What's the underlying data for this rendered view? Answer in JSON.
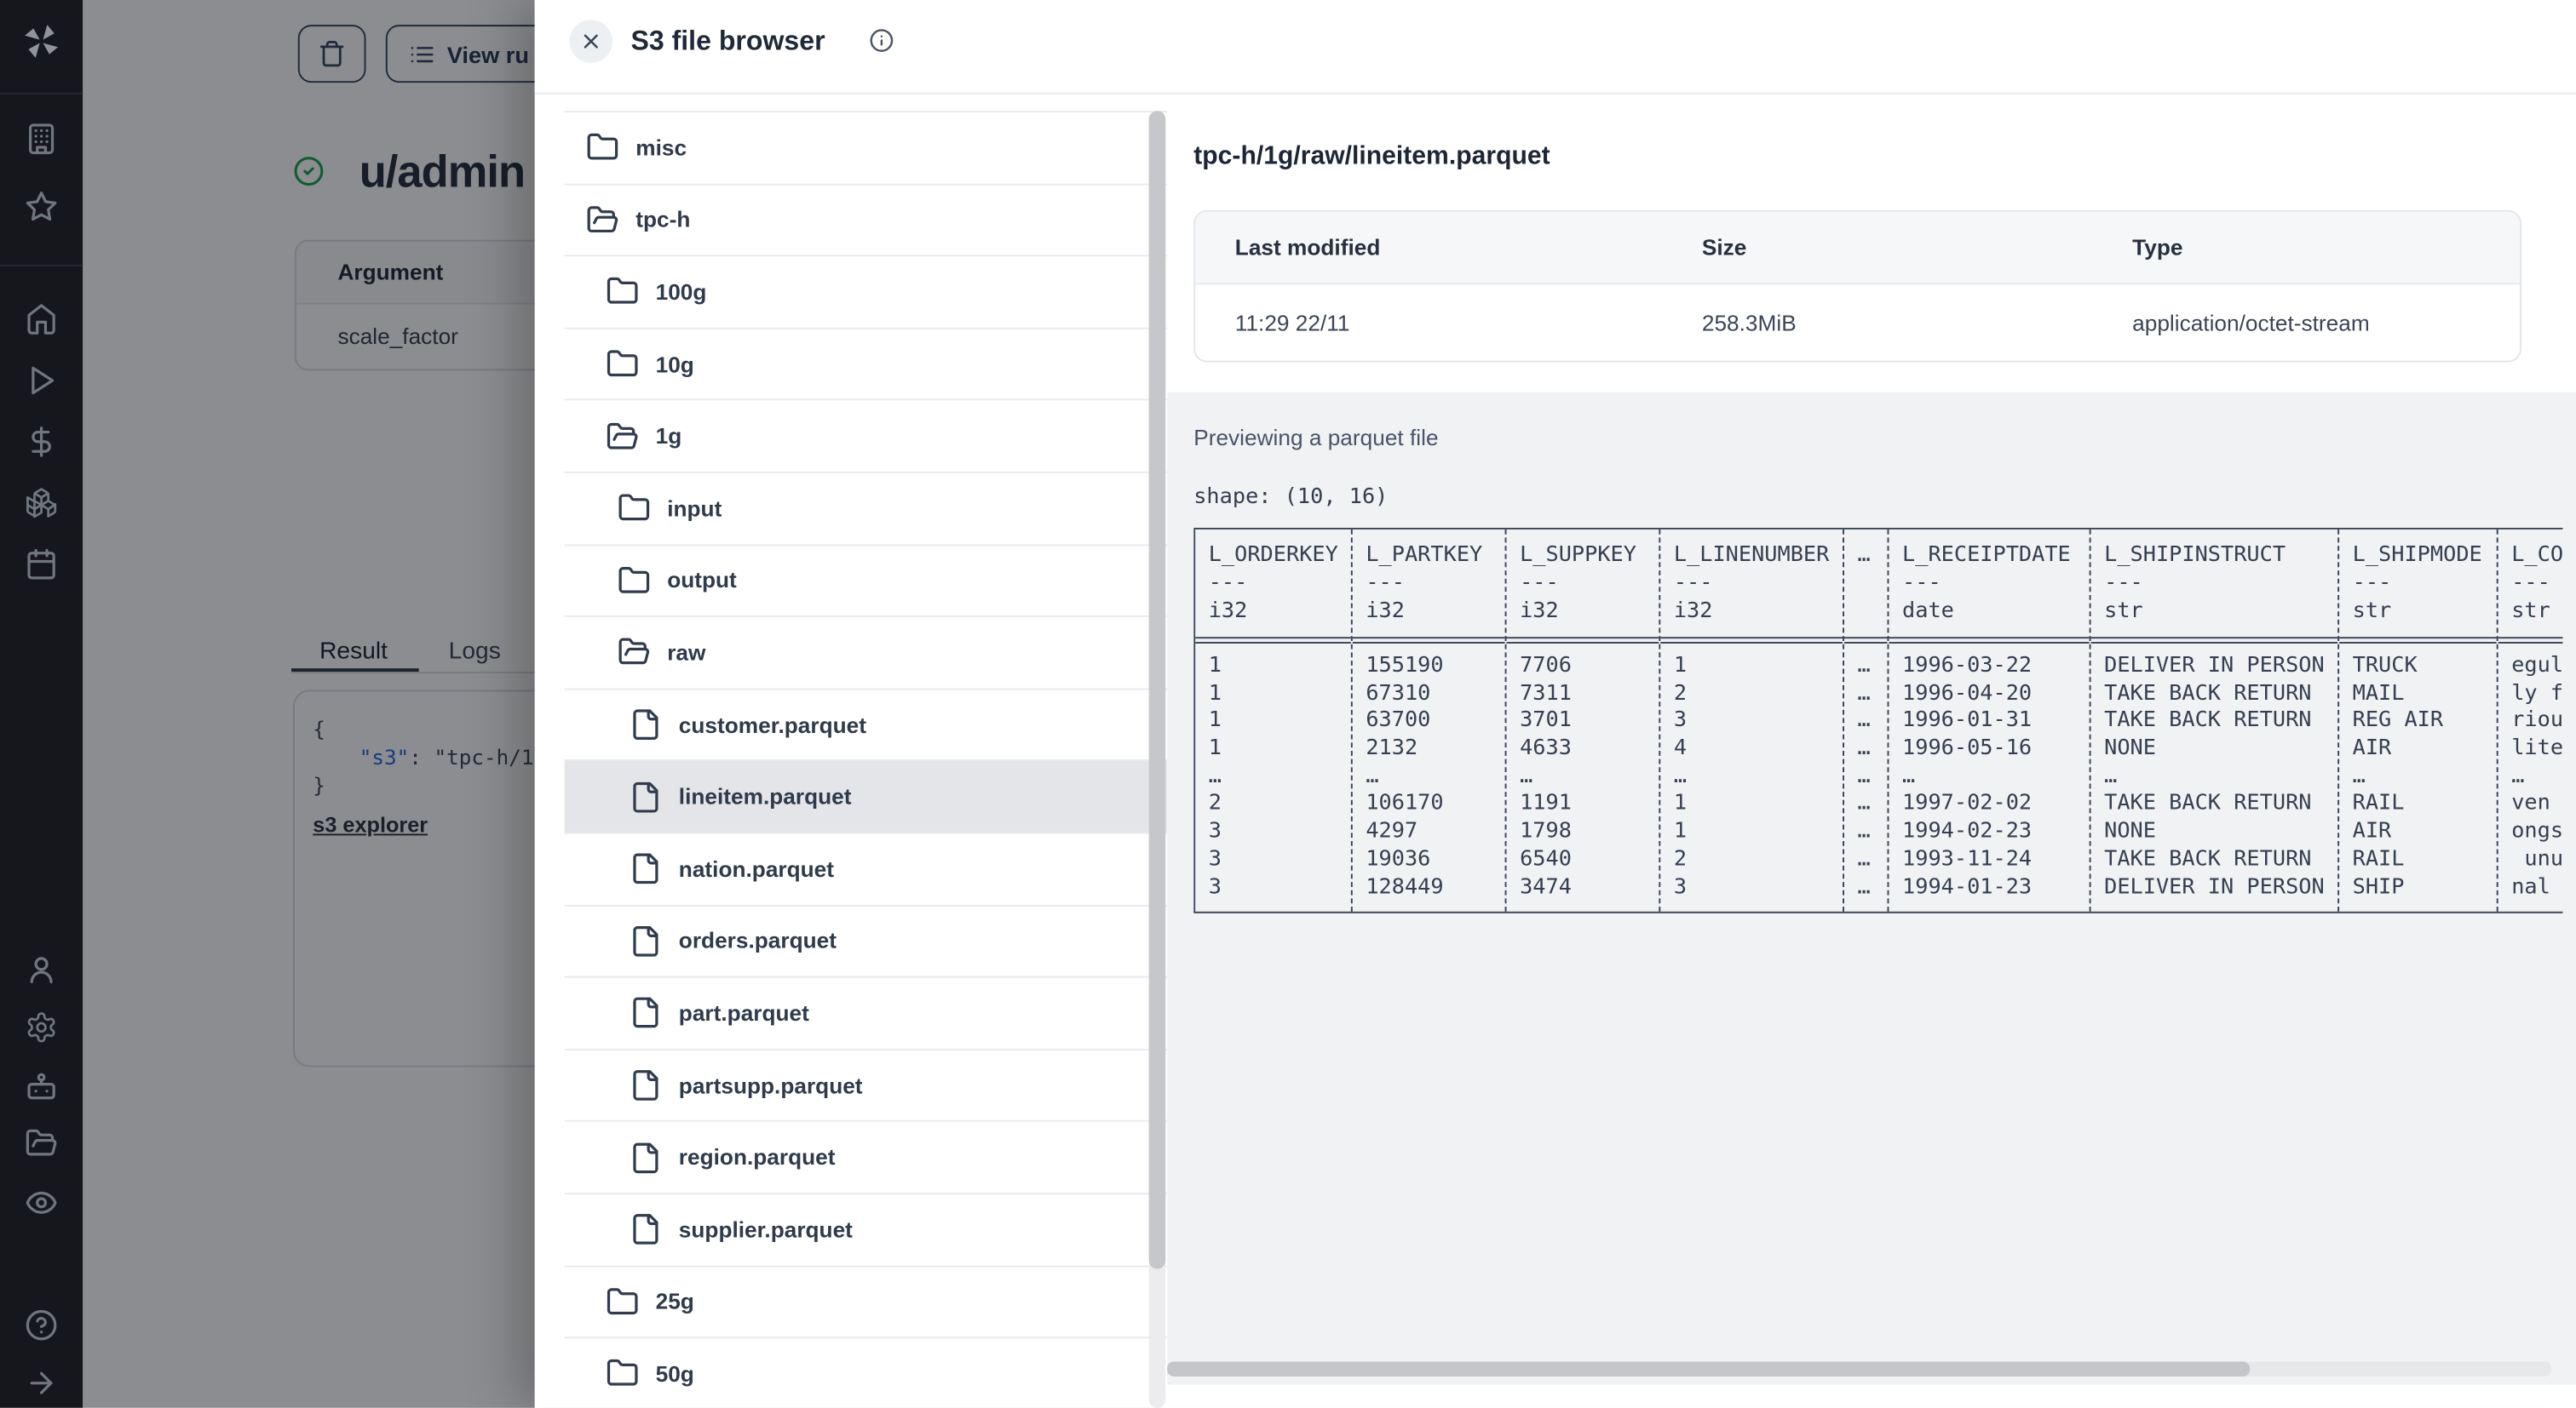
{
  "sidebar": {
    "logo": "windmill-logo",
    "top_icons": [
      "building",
      "star"
    ],
    "nav_icons": [
      "home",
      "play",
      "dollar",
      "boxes",
      "calendar"
    ],
    "bottom_icons": [
      "user",
      "settings",
      "bot",
      "folder-open",
      "eye"
    ],
    "footer_icons": [
      "help",
      "arrow-right"
    ]
  },
  "page": {
    "view_runs_label": "View ru",
    "title": "u/admin",
    "args_table": {
      "header": "Argument",
      "rows": [
        "scale_factor"
      ]
    },
    "tabs": {
      "items": [
        "Result",
        "Logs"
      ],
      "active": "Result"
    },
    "result_json": {
      "open_brace": "{",
      "key": "\"s3\"",
      "colon": ": ",
      "value": "\"tpc-h/1",
      "close_brace": "}"
    },
    "s3_explorer_link": "s3 explorer"
  },
  "modal": {
    "title": "S3 file browser",
    "close_label": "close",
    "tree": {
      "items": [
        {
          "label": "misc",
          "icon": "folder",
          "level": 0,
          "selected": false
        },
        {
          "label": "tpc-h",
          "icon": "folder-open",
          "level": 0,
          "selected": false
        },
        {
          "label": "100g",
          "icon": "folder",
          "level": 1,
          "selected": false
        },
        {
          "label": "10g",
          "icon": "folder",
          "level": 1,
          "selected": false
        },
        {
          "label": "1g",
          "icon": "folder-open",
          "level": 1,
          "selected": false
        },
        {
          "label": "input",
          "icon": "folder",
          "level": 2,
          "selected": false
        },
        {
          "label": "output",
          "icon": "folder",
          "level": 2,
          "selected": false
        },
        {
          "label": "raw",
          "icon": "folder-open",
          "level": 2,
          "selected": false
        },
        {
          "label": "customer.parquet",
          "icon": "file",
          "level": 3,
          "selected": false
        },
        {
          "label": "lineitem.parquet",
          "icon": "file",
          "level": 3,
          "selected": true
        },
        {
          "label": "nation.parquet",
          "icon": "file",
          "level": 3,
          "selected": false
        },
        {
          "label": "orders.parquet",
          "icon": "file",
          "level": 3,
          "selected": false
        },
        {
          "label": "part.parquet",
          "icon": "file",
          "level": 3,
          "selected": false
        },
        {
          "label": "partsupp.parquet",
          "icon": "file",
          "level": 3,
          "selected": false
        },
        {
          "label": "region.parquet",
          "icon": "file",
          "level": 3,
          "selected": false
        },
        {
          "label": "supplier.parquet",
          "icon": "file",
          "level": 3,
          "selected": false
        },
        {
          "label": "25g",
          "icon": "folder",
          "level": 1,
          "selected": false
        },
        {
          "label": "50g",
          "icon": "folder",
          "level": 1,
          "selected": false
        }
      ]
    },
    "preview": {
      "path": "tpc-h/1g/raw/lineitem.parquet",
      "meta": {
        "headers": [
          "Last modified",
          "Size",
          "Type"
        ],
        "values": [
          "11:29 22/11",
          "258.3MiB",
          "application/octet-stream"
        ]
      },
      "status_label": "Previewing a parquet file",
      "shape_label": "shape: (10, 16)",
      "type_separator": "---",
      "table": {
        "columns": [
          {
            "name": "L_ORDERKEY",
            "dtype": "i32",
            "values": [
              "1",
              "1",
              "1",
              "1",
              "…",
              "2",
              "3",
              "3",
              "3"
            ]
          },
          {
            "name": "L_PARTKEY",
            "dtype": "i32",
            "values": [
              "155190",
              "67310",
              "63700",
              "2132",
              "…",
              "106170",
              "4297",
              "19036",
              "128449"
            ]
          },
          {
            "name": "L_SUPPKEY",
            "dtype": "i32",
            "values": [
              "7706",
              "7311",
              "3701",
              "4633",
              "…",
              "1191",
              "1798",
              "6540",
              "3474"
            ]
          },
          {
            "name": "L_LINENUMBER",
            "dtype": "i32",
            "values": [
              "1",
              "2",
              "3",
              "4",
              "…",
              "1",
              "1",
              "2",
              "3"
            ]
          },
          {
            "name": "…",
            "dtype": "",
            "values": [
              "…",
              "…",
              "…",
              "…",
              "…",
              "…",
              "…",
              "…",
              "…"
            ]
          },
          {
            "name": "L_RECEIPTDATE",
            "dtype": "date",
            "values": [
              "1996-03-22",
              "1996-04-20",
              "1996-01-31",
              "1996-05-16",
              "…",
              "1997-02-02",
              "1994-02-23",
              "1993-11-24",
              "1994-01-23"
            ]
          },
          {
            "name": "L_SHIPINSTRUCT",
            "dtype": "str",
            "values": [
              "DELIVER IN PERSON",
              "TAKE BACK RETURN",
              "TAKE BACK RETURN",
              "NONE",
              "…",
              "TAKE BACK RETURN",
              "NONE",
              "TAKE BACK RETURN",
              "DELIVER IN PERSON"
            ]
          },
          {
            "name": "L_SHIPMODE",
            "dtype": "str",
            "values": [
              "TRUCK",
              "MAIL",
              "REG AIR",
              "AIR",
              "…",
              "RAIL",
              "AIR",
              "RAIL",
              "SHIP"
            ]
          },
          {
            "name": "L_CO",
            "dtype": "str",
            "values": [
              "egul",
              "ly f",
              "riou",
              "lite",
              "…",
              "ven",
              "ongs",
              " unu",
              "nal"
            ]
          }
        ]
      }
    }
  },
  "colors": {
    "sidebar_bg": "#15171c",
    "ink_navy": "#323c4d",
    "selected_row": "#e3e5e9",
    "preview_bg": "#f1f2f4",
    "green_check": "#16a34a",
    "json_key_blue": "#2563eb"
  }
}
